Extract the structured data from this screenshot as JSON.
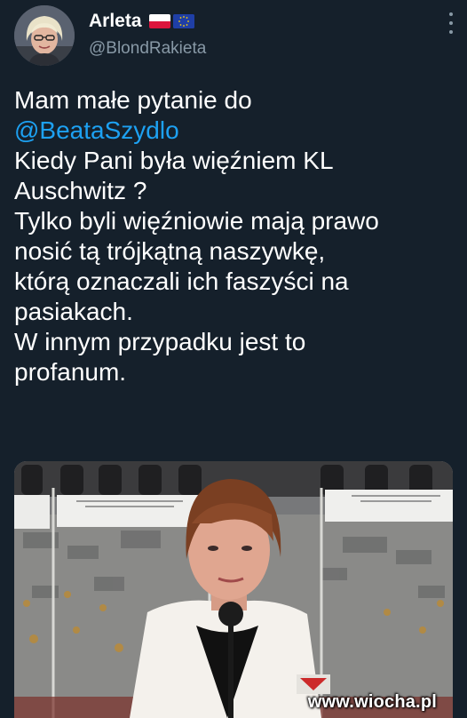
{
  "author": {
    "display_name": "Arleta",
    "handle": "@BlondRakieta",
    "flags": [
      "poland-flag-icon",
      "eu-flag-icon"
    ]
  },
  "menu": {
    "icon": "more-vertical-icon"
  },
  "tweet": {
    "lines": [
      {
        "text": "Mam małe pytanie do"
      },
      {
        "mention": "@BeataSzydlo"
      },
      {
        "text": "Kiedy Pani była więźniem KL"
      },
      {
        "text": "Auschwitz ?"
      },
      {
        "text": "Tylko byli więźniowie mają prawo"
      },
      {
        "text": "nosić tą trójkątną naszywkę,"
      },
      {
        "text": "którą oznaczali ich faszyści na"
      },
      {
        "text": "pasiakach."
      },
      {
        "text": "W innym przypadku jest to"
      },
      {
        "text": "profanum."
      }
    ]
  },
  "media": {
    "watermark": "www.wiocha.pl"
  },
  "colors": {
    "background": "#15202b",
    "text": "#ffffff",
    "secondary_text": "#8899a6",
    "mention": "#1da1f2"
  }
}
